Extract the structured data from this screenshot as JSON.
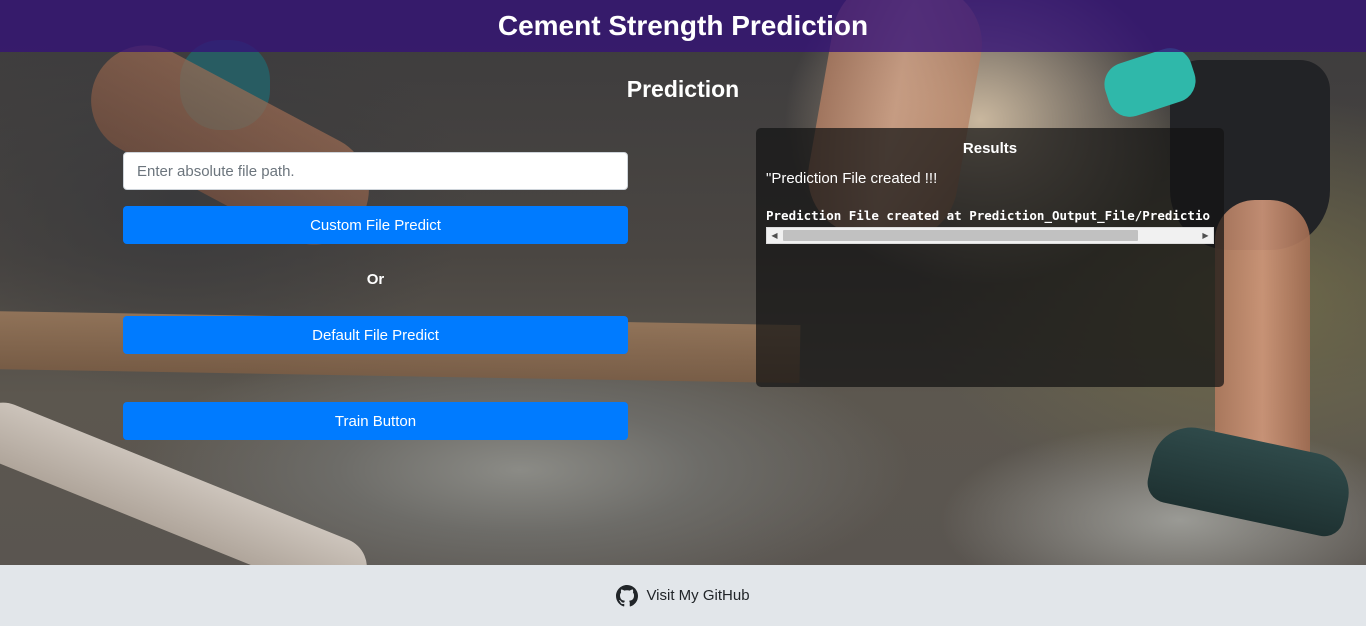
{
  "header": {
    "title": "Cement Strength Prediction"
  },
  "section": {
    "title": "Prediction"
  },
  "form": {
    "path_placeholder": "Enter absolute file path.",
    "path_value": "",
    "custom_predict_label": "Custom File Predict",
    "or_label": "Or",
    "default_predict_label": "Default File Predict",
    "train_label": "Train Button"
  },
  "results": {
    "title": "Results",
    "message": "\"Prediction File created !!!",
    "output_line": "Prediction File created at Prediction_Output_File/Predictio"
  },
  "footer": {
    "github_label": "Visit My GitHub",
    "github_icon": "github-icon"
  },
  "colors": {
    "header_bg": "#341278",
    "button_bg": "#007bff",
    "footer_bg": "#e2e6ea"
  }
}
